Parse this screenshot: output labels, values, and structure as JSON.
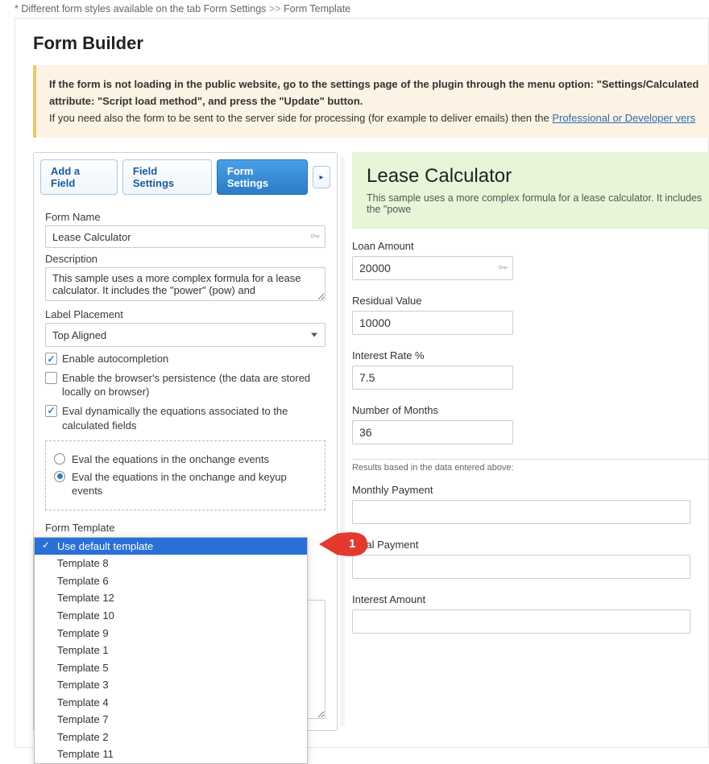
{
  "top_note": {
    "prefix": "* Different form styles available on the tab ",
    "path1": "Form Settings",
    "sep": " >> ",
    "path2": "Form Template"
  },
  "page_title": "Form Builder",
  "notice": {
    "line1a": "If the form is not loading in the public website, go to the settings page of the plugin through the menu option: \"Settings/Calculated",
    "line1b": "attribute: \"Script load method\", and press the \"Update\" button.",
    "line2_pre": "If you need also the form to be sent to the server side for processing (for example to deliver emails) then the ",
    "line2_link": "Professional or Developer vers"
  },
  "tabs": {
    "add_field": "Add a Field",
    "field_settings": "Field Settings",
    "form_settings": "Form Settings"
  },
  "form_settings": {
    "form_name_label": "Form Name",
    "form_name_value": "Lease Calculator",
    "description_label": "Description",
    "description_value": "This sample uses a more complex formula for a lease calculator. It includes the \"power\" (pow) and",
    "label_placement_label": "Label Placement",
    "label_placement_value": "Top Aligned",
    "chk_autocomplete": "Enable autocompletion",
    "chk_persistence": "Enable the browser's persistence (the data are stored locally on browser)",
    "chk_eval_dyn": "Eval dynamically the equations associated to the calculated fields",
    "radio_onchange": "Eval the equations in the onchange events",
    "radio_onchange_keyup": "Eval the equations in the onchange and keyup events",
    "form_template_label": "Form Template"
  },
  "template_options": [
    "Use default template",
    "Template 8",
    "Template 6",
    "Template 12",
    "Template 10",
    "Template 9",
    "Template 1",
    "Template 5",
    "Template 3",
    "Template 4",
    "Template 7",
    "Template 2",
    "Template 11"
  ],
  "annotation_number": "1",
  "preview": {
    "title": "Lease Calculator",
    "subtitle": "This sample uses a more complex formula for a lease calculator. It includes the \"powe",
    "fields": {
      "loan_amount_label": "Loan Amount",
      "loan_amount_value": "20000",
      "residual_label": "Residual Value",
      "residual_value": "10000",
      "interest_label": "Interest Rate %",
      "interest_value": "7.5",
      "months_label": "Number of Months",
      "months_value": "36",
      "results_note": "Results based in the data entered above:",
      "monthly_label": "Monthly Payment",
      "total_label": "Total Payment",
      "interest_amount_label": "Interest Amount"
    }
  }
}
